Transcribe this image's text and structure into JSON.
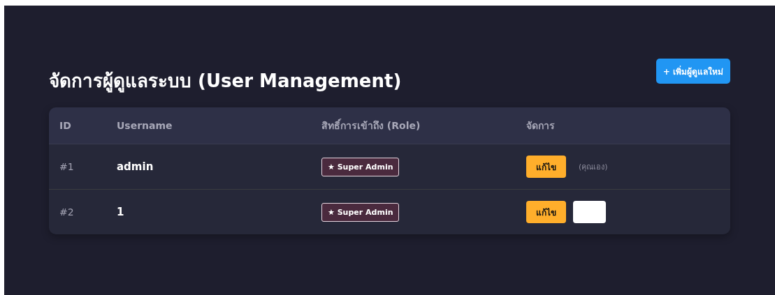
{
  "title": "จัดการผู้ดูแลระบบ (User Management)",
  "add_button": "+ เพิ่มผู้ดูแลใหม่",
  "table": {
    "columns": [
      "ID",
      "Username",
      "สิทธิ์การเข้าถึง (Role)",
      "จัดการ"
    ],
    "rows": [
      {
        "id": "#1",
        "username": "admin",
        "role": "★ Super Admin",
        "actions": [
          {
            "kind": "edit",
            "label": "แก้ไข"
          },
          {
            "kind": "note",
            "label": "(คุณเอง)"
          }
        ]
      },
      {
        "id": "#2",
        "username": "1",
        "role": "★ Super Admin",
        "actions": [
          {
            "kind": "edit",
            "label": "แก้ไข"
          },
          {
            "kind": "blank"
          }
        ]
      }
    ]
  }
}
